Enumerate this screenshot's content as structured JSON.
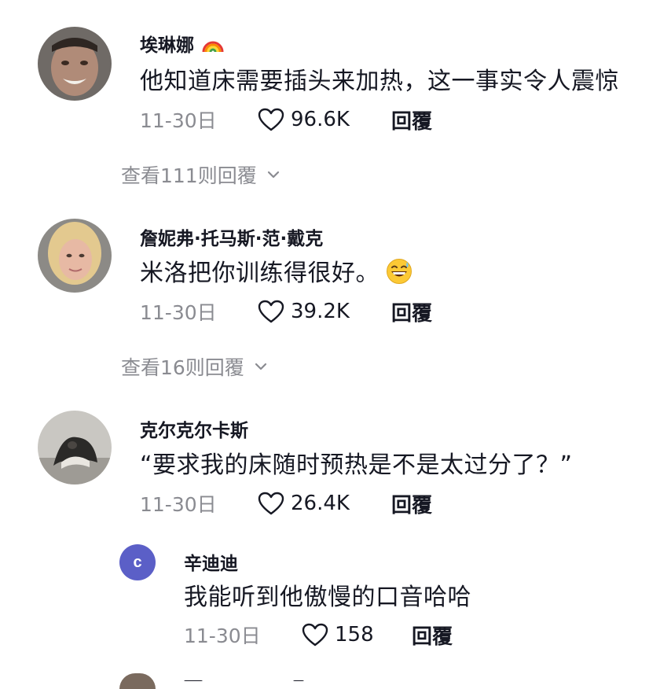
{
  "comments": [
    {
      "username": "埃琳娜",
      "username_emoji": "rainbow-icon",
      "text": "他知道床需要插头来加热，这一事实令人震惊",
      "date": "11-30日",
      "likes": "96.6K",
      "reply_label": "回覆",
      "view_replies": "查看111则回覆"
    },
    {
      "username": "詹妮弗·托马斯·范·戴克",
      "text": "米洛把你训练得很好。",
      "text_emoji": "grinning-sweat-emoji",
      "date": "11-30日",
      "likes": "39.2K",
      "reply_label": "回覆",
      "view_replies": "查看16则回覆"
    },
    {
      "username": "克尔克尔卡斯",
      "text": "“要求我的床随时预热是不是太过分了？”",
      "date": "11-30日",
      "likes": "26.4K",
      "reply_label": "回覆"
    }
  ],
  "reply": {
    "avatar_letter": "c",
    "avatar_color": "#5b5fc7",
    "username": "辛迪迪",
    "text": "我能听到他傲慢的口音哈哈",
    "date": "11-30日",
    "likes": "158",
    "reply_label": "回覆"
  },
  "colors": {
    "secondary_text": "#8a8b91",
    "primary_text": "#161823"
  }
}
